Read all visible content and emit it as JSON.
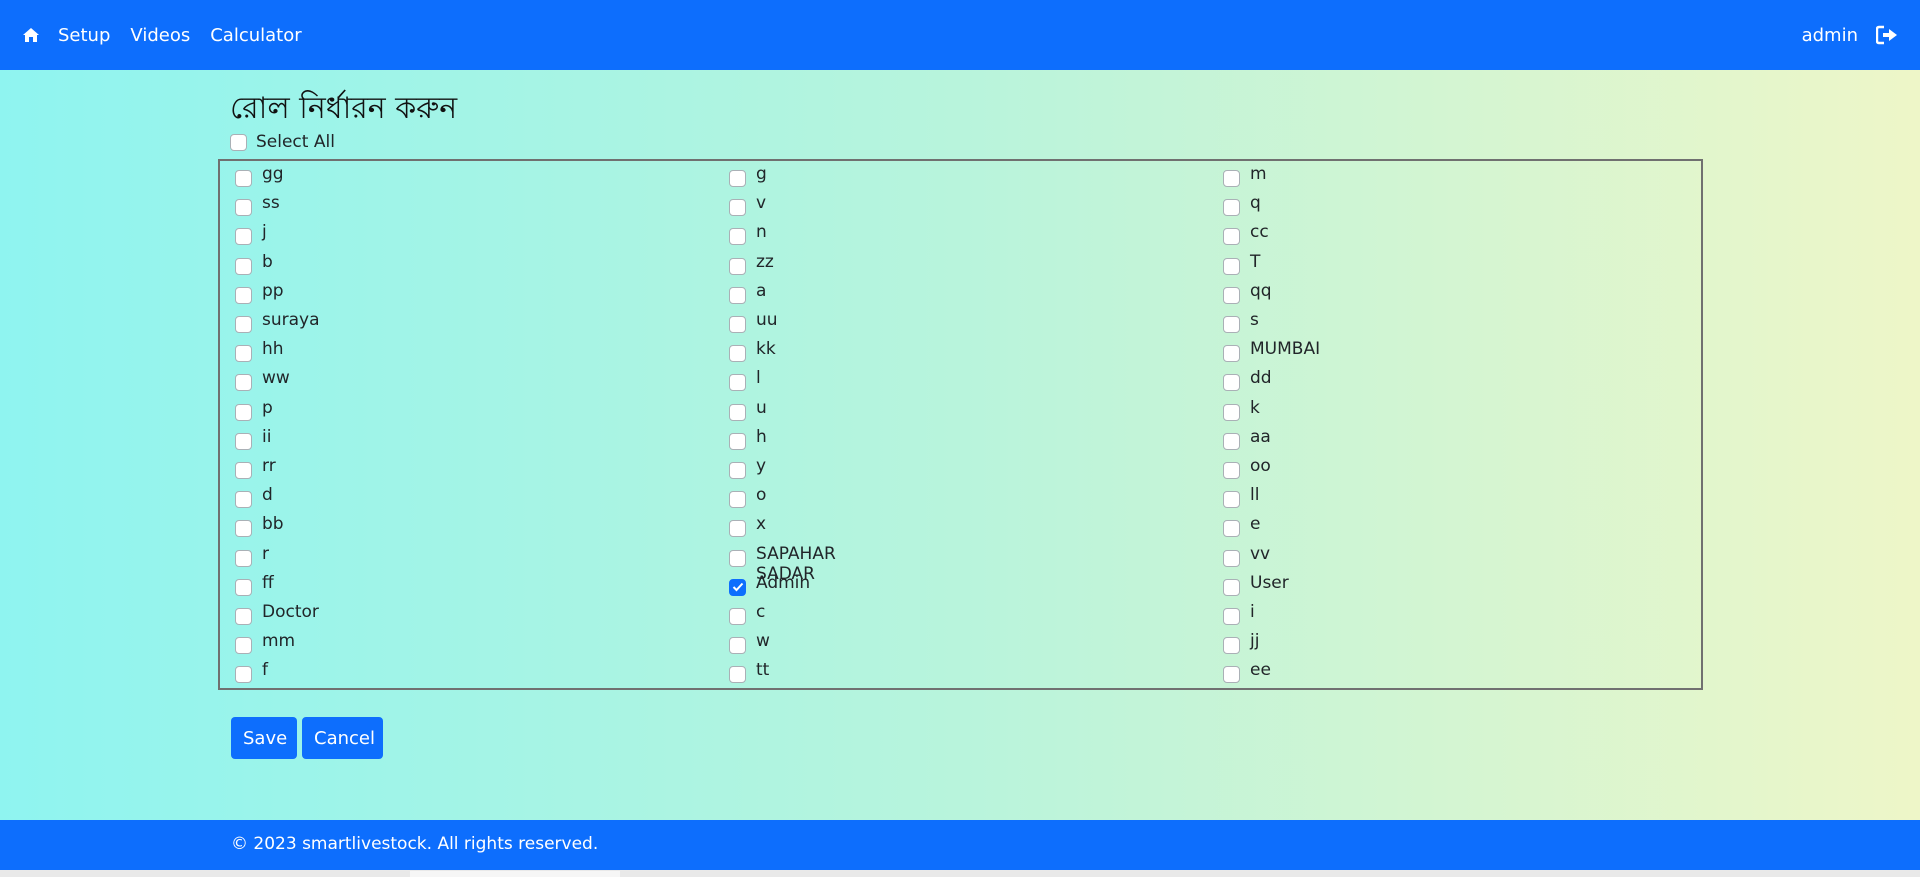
{
  "nav": {
    "home_icon": "home-icon",
    "links": [
      "Setup",
      "Videos",
      "Calculator"
    ],
    "user": "admin",
    "logout_icon": "sign-out-icon"
  },
  "page": {
    "title": "রোল নির্ধারন করুন",
    "select_all_label": "Select All",
    "select_all_checked": false
  },
  "roles": {
    "col1": [
      {
        "label": "gg",
        "checked": false
      },
      {
        "label": "ss",
        "checked": false
      },
      {
        "label": "j",
        "checked": false
      },
      {
        "label": "b",
        "checked": false
      },
      {
        "label": "pp",
        "checked": false
      },
      {
        "label": "suraya",
        "checked": false
      },
      {
        "label": "hh",
        "checked": false
      },
      {
        "label": "ww",
        "checked": false
      },
      {
        "label": "p",
        "checked": false
      },
      {
        "label": "ii",
        "checked": false
      },
      {
        "label": "rr",
        "checked": false
      },
      {
        "label": "d",
        "checked": false
      },
      {
        "label": "bb",
        "checked": false
      },
      {
        "label": "r",
        "checked": false
      },
      {
        "label": "ff",
        "checked": false
      },
      {
        "label": "Doctor",
        "checked": false
      },
      {
        "label": "mm",
        "checked": false
      },
      {
        "label": "f",
        "checked": false
      }
    ],
    "col2": [
      {
        "label": "g",
        "checked": false
      },
      {
        "label": "v",
        "checked": false
      },
      {
        "label": "n",
        "checked": false
      },
      {
        "label": "zz",
        "checked": false
      },
      {
        "label": "a",
        "checked": false
      },
      {
        "label": "uu",
        "checked": false
      },
      {
        "label": "kk",
        "checked": false
      },
      {
        "label": "l",
        "checked": false
      },
      {
        "label": "u",
        "checked": false
      },
      {
        "label": "h",
        "checked": false
      },
      {
        "label": "y",
        "checked": false
      },
      {
        "label": "o",
        "checked": false
      },
      {
        "label": "x",
        "checked": false
      },
      {
        "label": "SAPAHAR SADAR",
        "checked": false
      },
      {
        "label": "Admin",
        "checked": true
      },
      {
        "label": "c",
        "checked": false
      },
      {
        "label": "w",
        "checked": false
      },
      {
        "label": "tt",
        "checked": false
      }
    ],
    "col3": [
      {
        "label": "m",
        "checked": false
      },
      {
        "label": "q",
        "checked": false
      },
      {
        "label": "cc",
        "checked": false
      },
      {
        "label": "T",
        "checked": false
      },
      {
        "label": "qq",
        "checked": false
      },
      {
        "label": "s",
        "checked": false
      },
      {
        "label": "MUMBAI",
        "checked": false
      },
      {
        "label": "dd",
        "checked": false
      },
      {
        "label": "k",
        "checked": false
      },
      {
        "label": "aa",
        "checked": false
      },
      {
        "label": "oo",
        "checked": false
      },
      {
        "label": "ll",
        "checked": false
      },
      {
        "label": "e",
        "checked": false
      },
      {
        "label": "vv",
        "checked": false
      },
      {
        "label": "User",
        "checked": false
      },
      {
        "label": "i",
        "checked": false
      },
      {
        "label": "jj",
        "checked": false
      },
      {
        "label": "ee",
        "checked": false
      }
    ]
  },
  "buttons": {
    "save": "Save",
    "cancel": "Cancel"
  },
  "footer": {
    "text": "© 2023 smartlivestock. All rights reserved."
  },
  "colors": {
    "primary": "#0d6efd",
    "background_start": "#8ff4f0",
    "background_end": "#eef6c8"
  }
}
